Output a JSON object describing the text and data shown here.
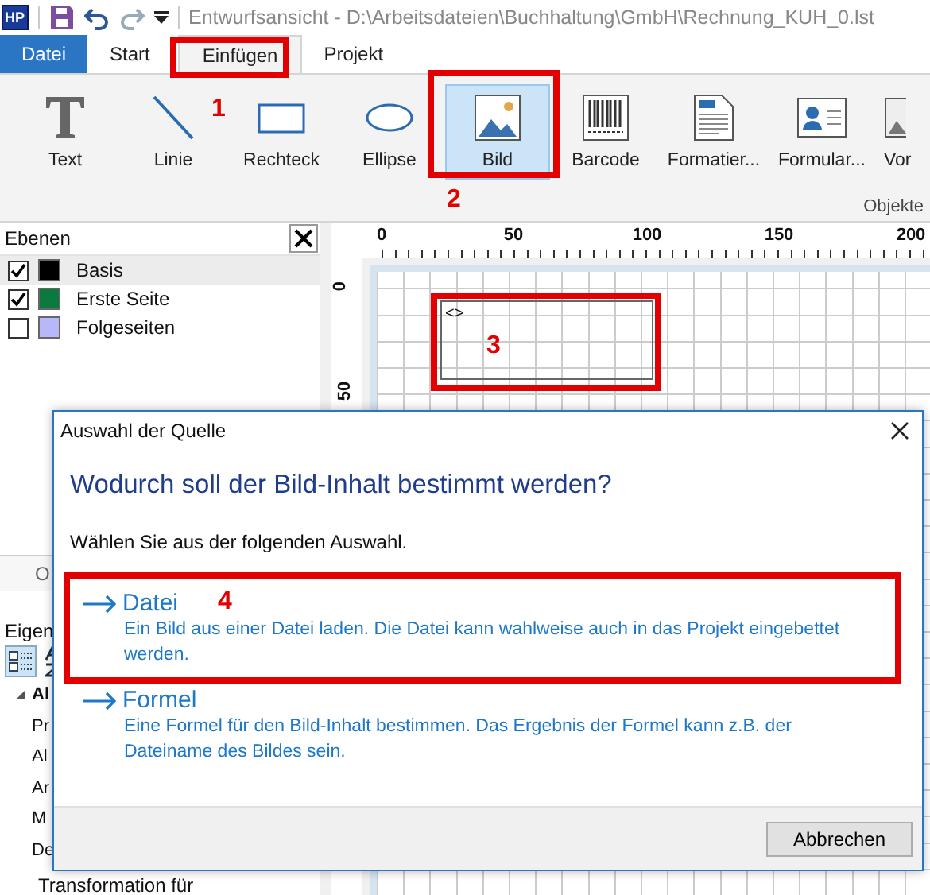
{
  "title_bar": {
    "logo": "HP",
    "title": "Entwurfsansicht - D:\\Arbeitsdateien\\Buchhaltung\\GmbH\\Rechnung_KUH_0.lst"
  },
  "menu_tabs": [
    {
      "label": "Datei",
      "kind": "file",
      "selected": false
    },
    {
      "label": "Start",
      "kind": "tab",
      "selected": false
    },
    {
      "label": "Einfügen",
      "kind": "tab",
      "selected": true
    },
    {
      "label": "Projekt",
      "kind": "tab",
      "selected": false
    }
  ],
  "ribbon": {
    "group_label": "Objekte",
    "buttons": [
      {
        "label": "Text",
        "selected": false
      },
      {
        "label": "Linie",
        "selected": false
      },
      {
        "label": "Rechteck",
        "selected": false
      },
      {
        "label": "Ellipse",
        "selected": false
      },
      {
        "label": "Bild",
        "selected": true
      },
      {
        "label": "Barcode",
        "selected": false
      },
      {
        "label": "Formatier...",
        "selected": false
      },
      {
        "label": "Formular...",
        "selected": false
      },
      {
        "label": "Vor",
        "selected": false
      }
    ]
  },
  "layers_panel": {
    "title": "Ebenen",
    "layers": [
      {
        "name": "Basis",
        "checked": true,
        "color": "#000000",
        "selected": true
      },
      {
        "name": "Erste Seite",
        "checked": true,
        "color": "#0b7a3e",
        "selected": false
      },
      {
        "name": "Folgeseiten",
        "checked": false,
        "color": "#b8b8f8",
        "selected": false
      }
    ]
  },
  "rulers": {
    "x_labels": [
      "0",
      "50",
      "100",
      "150",
      "200"
    ],
    "y_labels": [
      "0",
      "50"
    ]
  },
  "canvas_object": {
    "text": "<>"
  },
  "properties_panel": {
    "button": "O",
    "title": "Eigen",
    "items": [
      {
        "label": "Al",
        "kind": "group"
      },
      {
        "label": "Pr",
        "kind": "property"
      },
      {
        "label": "Al",
        "kind": "property"
      },
      {
        "label": "Ar",
        "kind": "property"
      },
      {
        "label": "M",
        "kind": "property"
      },
      {
        "label": "De",
        "kind": "property"
      },
      {
        "label": "Transformation für",
        "kind": "property"
      }
    ]
  },
  "dialog": {
    "title": "Auswahl der Quelle",
    "heading": "Wodurch soll der Bild-Inhalt bestimmt werden?",
    "instruction": "Wählen Sie aus der folgenden Auswahl.",
    "options": [
      {
        "title": "Datei",
        "description": "Ein Bild aus einer Datei laden. Die Datei kann wahlweise auch in das Projekt eingebettet werden."
      },
      {
        "title": "Formel",
        "description": "Eine Formel für den Bild-Inhalt bestimmen. Das Ergebnis der Formel kann z.B. der Dateiname des Bildes sein."
      }
    ],
    "cancel_button": "Abbrechen"
  },
  "annotations": [
    {
      "label": "1"
    },
    {
      "label": "2"
    },
    {
      "label": "3"
    },
    {
      "label": "4"
    }
  ]
}
